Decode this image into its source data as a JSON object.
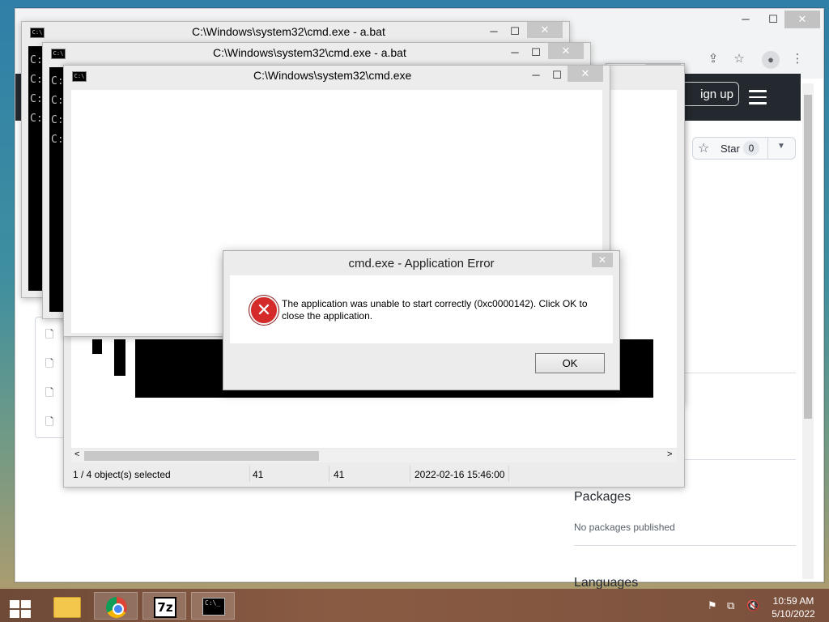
{
  "chrome": {
    "minimize": "─",
    "maximize": "☐",
    "close": "✕",
    "share_icon": "⇪",
    "star_icon": "☆",
    "avatar_icon": "●",
    "menu_icon": "⋮",
    "signup": "ign up",
    "star_label": "Star",
    "star_count": "0",
    "packages_title": "Packages",
    "packages_sub": "No packages published",
    "languages_title": "Languages"
  },
  "windows": {
    "cmd1_title": "C:\\Windows\\system32\\cmd.exe - a.bat",
    "cmd2_title": "C:\\Windows\\system32\\cmd.exe - a.bat",
    "cmd3_title": "C:\\Windows\\system32\\cmd.exe",
    "console_prompt": "C:",
    "minimize": "─",
    "maximize": "☐",
    "close": "✕"
  },
  "dialog": {
    "title": "cmd.exe - Application Error",
    "message": "The application was unable to start correctly (0xc0000142). Click OK to close the application.",
    "ok": "OK",
    "close": "✕",
    "error_icon": "✕"
  },
  "explorer": {
    "status_selected": "1 / 4 object(s) selected",
    "status_size1": "41",
    "status_size2": "41",
    "status_date": "2022-02-16 15:46:00",
    "scroll_left": "<",
    "scroll_right": ">",
    "scroll_down": "v"
  },
  "taskbar": {
    "z7_label": "7z",
    "cmd_label": "C:\\_",
    "time": "10:59 AM",
    "date": "5/10/2022",
    "tray_flag": "⚑",
    "tray_network": "⧉",
    "tray_volume": "🔇"
  }
}
